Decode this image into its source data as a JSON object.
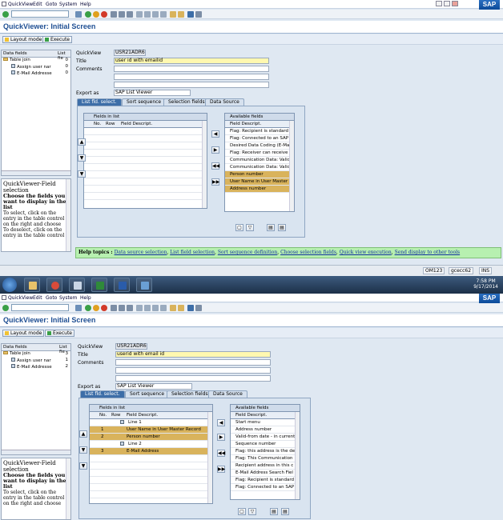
{
  "menu": [
    "QuickView",
    "Edit",
    "Goto",
    "System",
    "Help"
  ],
  "sap_logo": "SAP",
  "title": "QuickViewer: Initial Screen",
  "buttons": {
    "layout": "Layout mode",
    "execute": "Execute"
  },
  "left_head": {
    "data_fields": "Data fields",
    "list_fld": "List fie"
  },
  "tree": {
    "root": "Table join",
    "child1": "Assign user nar",
    "child2": "E-Mail Addresse"
  },
  "help_panel": {
    "title": "QuickViewer-Field selection",
    "bold": "Choose the fields you want to display in the list",
    "body1": "To select, click on the entry in the table control on the right and choose",
    "body2": "To deselect, click on the entry in the table control"
  },
  "form": {
    "quickview_label": "QuickView",
    "quickview_value": "USR21ADR6",
    "title_label": "Title",
    "comments_label": "Comments",
    "export_label": "Export as",
    "export_value": "SAP List Viewer"
  },
  "tabs": [
    "List fld. select.",
    "Sort sequence",
    "Selection fields",
    "Data Source"
  ],
  "grid": {
    "fields_in_list": "Fields in list",
    "col_no": "No.",
    "col_row": "Row",
    "col_desc": "Field Descript.",
    "available_fields": "Available fields",
    "avail_col_desc": "Field Descript."
  },
  "screen1": {
    "title_value": "user id with emailid",
    "counts": [
      "0",
      "0",
      "0"
    ],
    "available": [
      {
        "text": "Flag: Recipient is standard",
        "sel": false
      },
      {
        "text": "Flag: Connected to an SAP",
        "sel": false
      },
      {
        "text": "Desired Data Coding (E-Ma",
        "sel": false
      },
      {
        "text": "Flag: Receiver can receive",
        "sel": false
      },
      {
        "text": "Communication Data: Valid",
        "sel": false
      },
      {
        "text": "Communication Data: Valid",
        "sel": false
      },
      {
        "text": "Person number",
        "sel": true
      },
      {
        "text": "User Name in User Master",
        "sel": true
      },
      {
        "text": "Address number",
        "sel": true
      }
    ],
    "help_topics_label": "Help topics :",
    "help_topics": [
      "Data source selection",
      "List field selection",
      "Sort sequence definition",
      "Choose selection fields",
      "Quick view execution",
      "Send display to other tools"
    ],
    "status": {
      "sys": "OM123",
      "client": "gcecc62",
      "mode": "INS"
    },
    "clock": {
      "time": "7:58 PM",
      "date": "9/17/2014"
    }
  },
  "screen2": {
    "title_value": "userid with email id",
    "counts": [
      "3",
      "1",
      "2"
    ],
    "list": [
      {
        "no": "",
        "row": "",
        "desc": "Line 1",
        "sel": false,
        "line": true
      },
      {
        "no": "1",
        "row": "",
        "desc": "User Name in User Master Record",
        "sel": true
      },
      {
        "no": "2",
        "row": "",
        "desc": "Person number",
        "sel": true
      },
      {
        "no": "",
        "row": "",
        "desc": "Line 2",
        "sel": false,
        "line": true
      },
      {
        "no": "3",
        "row": "",
        "desc": "E-Mail Address",
        "sel": true
      }
    ],
    "available": [
      {
        "text": "Start menu",
        "sel": false
      },
      {
        "text": "Address number",
        "sel": false
      },
      {
        "text": "Valid-from date - in current",
        "sel": false
      },
      {
        "text": "Sequence number",
        "sel": false
      },
      {
        "text": "Flag: this address is the de",
        "sel": false
      },
      {
        "text": "Flag: This Communication",
        "sel": false
      },
      {
        "text": "Recipient address in this c",
        "sel": false
      },
      {
        "text": "E-Mail Address Search Fiel",
        "sel": false
      },
      {
        "text": "Flag: Recipient is standard",
        "sel": false
      },
      {
        "text": "Flag: Connected to an SAP",
        "sel": false
      }
    ]
  }
}
